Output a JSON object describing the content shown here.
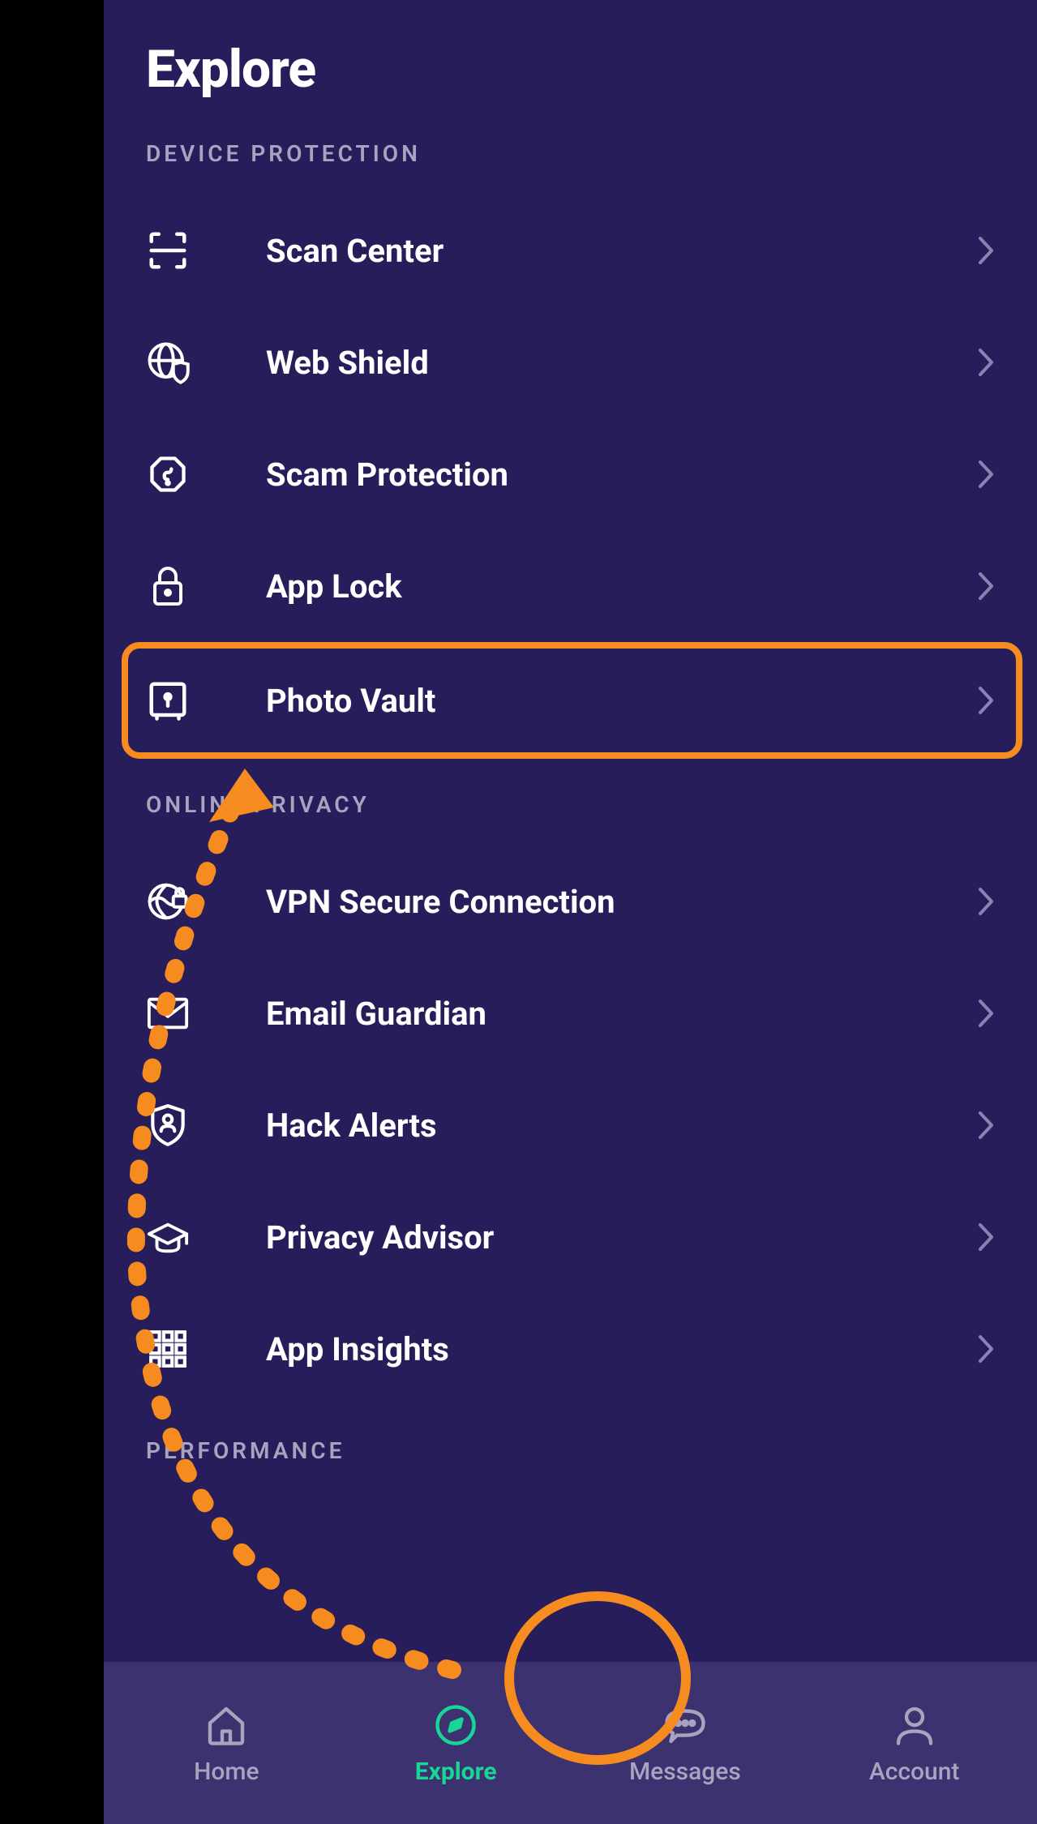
{
  "header": {
    "title": "Explore"
  },
  "sections": {
    "device_protection": {
      "label": "DEVICE PROTECTION",
      "items": [
        {
          "label": "Scan Center"
        },
        {
          "label": "Web Shield"
        },
        {
          "label": "Scam Protection"
        },
        {
          "label": "App Lock"
        },
        {
          "label": "Photo Vault"
        }
      ]
    },
    "online_privacy": {
      "label": "ONLINE PRIVACY",
      "items": [
        {
          "label": "VPN Secure Connection"
        },
        {
          "label": "Email Guardian"
        },
        {
          "label": "Hack Alerts"
        },
        {
          "label": "Privacy Advisor"
        },
        {
          "label": "App Insights"
        }
      ]
    },
    "performance": {
      "label": "PERFORMANCE"
    }
  },
  "tabs": [
    {
      "label": "Home"
    },
    {
      "label": "Explore"
    },
    {
      "label": "Messages"
    },
    {
      "label": "Account"
    }
  ],
  "annotations": {
    "highlighted_item": "Photo Vault",
    "active_tab": "Explore"
  }
}
